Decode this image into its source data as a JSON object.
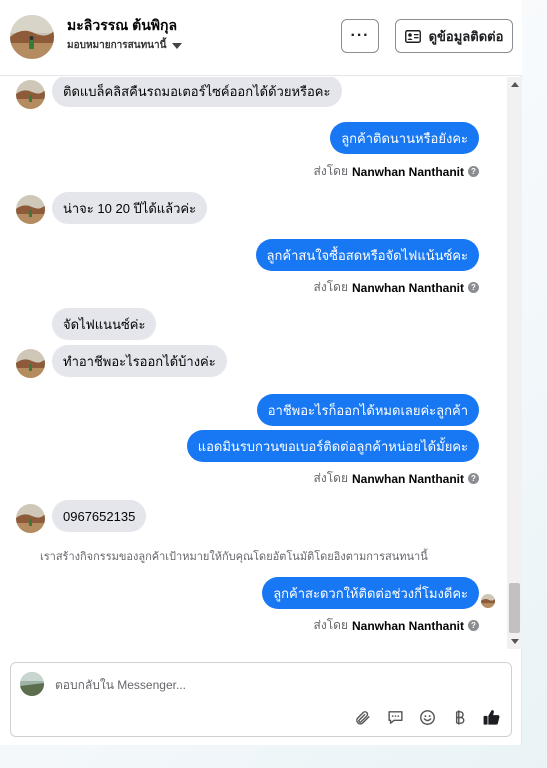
{
  "header": {
    "name": "มะลิวรรณ ต้นพิกุล",
    "assignee": "มอบหมายการสนทนานี้",
    "more_label": "···",
    "contact_label": "ดูข้อมูลติดต่อ"
  },
  "messages": [
    {
      "dir": "in",
      "text": "ติดแบล็คลิสคืนรถมอเตอร์ไซค์ออกได้ด้วยหรือคะ"
    },
    {
      "dir": "out",
      "text": "ลูกค้าติดนานหรือยังคะ"
    },
    {
      "dir": "sent",
      "prefix": "ส่งโดย",
      "name": "Nanwhan Nanthanit"
    },
    {
      "dir": "in",
      "text": "น่าจะ 10 20 ปีได้แล้วค่ะ"
    },
    {
      "dir": "out",
      "text": "ลูกค้าสนใจซื้อสดหรือจัดไฟแน้นซ์คะ"
    },
    {
      "dir": "sent",
      "prefix": "ส่งโดย",
      "name": "Nanwhan Nanthanit"
    },
    {
      "dir": "in",
      "text": "จัดไฟแนนซ์ค่ะ"
    },
    {
      "dir": "in",
      "text": "ทำอาชีพอะไรออกได้บ้างค่ะ"
    },
    {
      "dir": "out",
      "text": "อาชีพอะไรก็ออกได้หมดเลยค่ะลูกค้า"
    },
    {
      "dir": "out",
      "text": "แอดมินรบกวนขอเบอร์ติดต่อลูกค้าหน่อยได้มั้ยคะ"
    },
    {
      "dir": "sent",
      "prefix": "ส่งโดย",
      "name": "Nanwhan Nanthanit"
    },
    {
      "dir": "in",
      "text": "0967652135"
    },
    {
      "dir": "note",
      "text": "เราสร้างกิจกรรมของลูกค้าเป้าหมายให้กับคุณโดยอัตโนมัติโดยอิงตามการสนทนานี้"
    },
    {
      "dir": "out",
      "text": "ลูกค้าสะดวกให้ติดต่อช่วงกี่โมงดีคะ"
    },
    {
      "dir": "sent",
      "prefix": "ส่งโดย",
      "name": "Nanwhan Nanthanit"
    }
  ],
  "composer": {
    "placeholder": "ตอบกลับใน Messenger..."
  },
  "colors": {
    "accent": "#1877f2",
    "incoming_bubble": "#e4e6eb"
  },
  "icons": [
    "more-icon",
    "contact-card-icon",
    "chevron-down-icon",
    "help-icon",
    "attach-icon",
    "saved-replies-icon",
    "emoji-icon",
    "payment-icon",
    "like-icon"
  ]
}
